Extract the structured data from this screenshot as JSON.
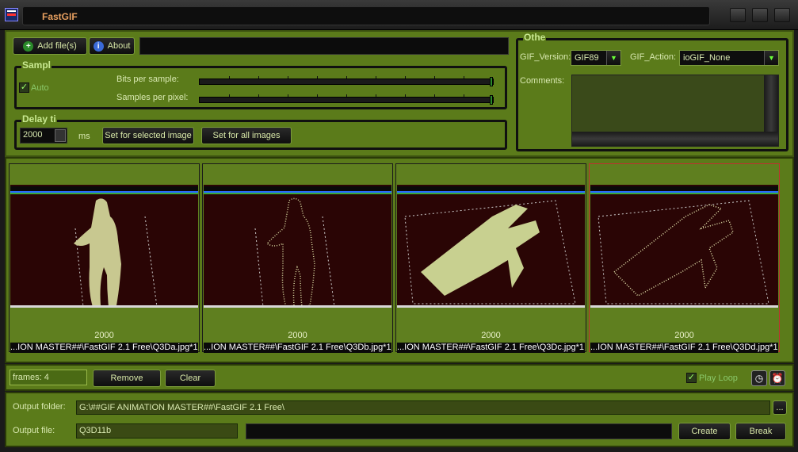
{
  "window": {
    "title": "FastGIF"
  },
  "toolbar": {
    "add_files_label": "Add file(s)",
    "about_label": "About"
  },
  "sample": {
    "group_title": "Sampl",
    "auto_label": "Auto",
    "auto_checked": true,
    "bits_label": "Bits per sample:",
    "bits_level": 1.0,
    "samples_label": "Samples per pixel:",
    "samples_level": 1.0
  },
  "delay": {
    "group_title": "Delay ti",
    "value": "2000",
    "unit": "ms",
    "set_selected_label": "Set for selected image",
    "set_all_label": "Set for all images"
  },
  "other": {
    "group_title": "Othe",
    "gif_version_label": "GIF_Version:",
    "gif_version_value": "GIF89",
    "gif_action_label": "GIF_Action:",
    "gif_action_value": "ioGIF_None",
    "comments_label": "Comments:"
  },
  "thumbnails": [
    {
      "delay": "2000",
      "file": "...ION MASTER##\\FastGIF 2.1 Free\\Q3Da.jpg*1"
    },
    {
      "delay": "2000",
      "file": "...ION MASTER##\\FastGIF 2.1 Free\\Q3Db.jpg*1"
    },
    {
      "delay": "2000",
      "file": "...ION MASTER##\\FastGIF 2.1 Free\\Q3Dc.jpg*1"
    },
    {
      "delay": "2000",
      "file": "...ION MASTER##\\FastGIF 2.1 Free\\Q3Dd.jpg*1"
    }
  ],
  "frames": {
    "count_label": "frames: 4",
    "remove_label": "Remove",
    "clear_label": "Clear",
    "play_loop_label": "Play Loop",
    "play_loop_checked": true
  },
  "output": {
    "folder_label": "Output folder:",
    "folder_value": "G:\\##GIF ANIMATION MASTER##\\FastGIF 2.1 Free\\",
    "browse_label": "...",
    "file_label": "Output file:",
    "file_value": "Q3D11b",
    "create_label": "Create",
    "break_label": "Break"
  },
  "colors": {
    "panel": "#5b7b1a",
    "accent": "#7a9a3a",
    "text": "#d8e8b0"
  }
}
